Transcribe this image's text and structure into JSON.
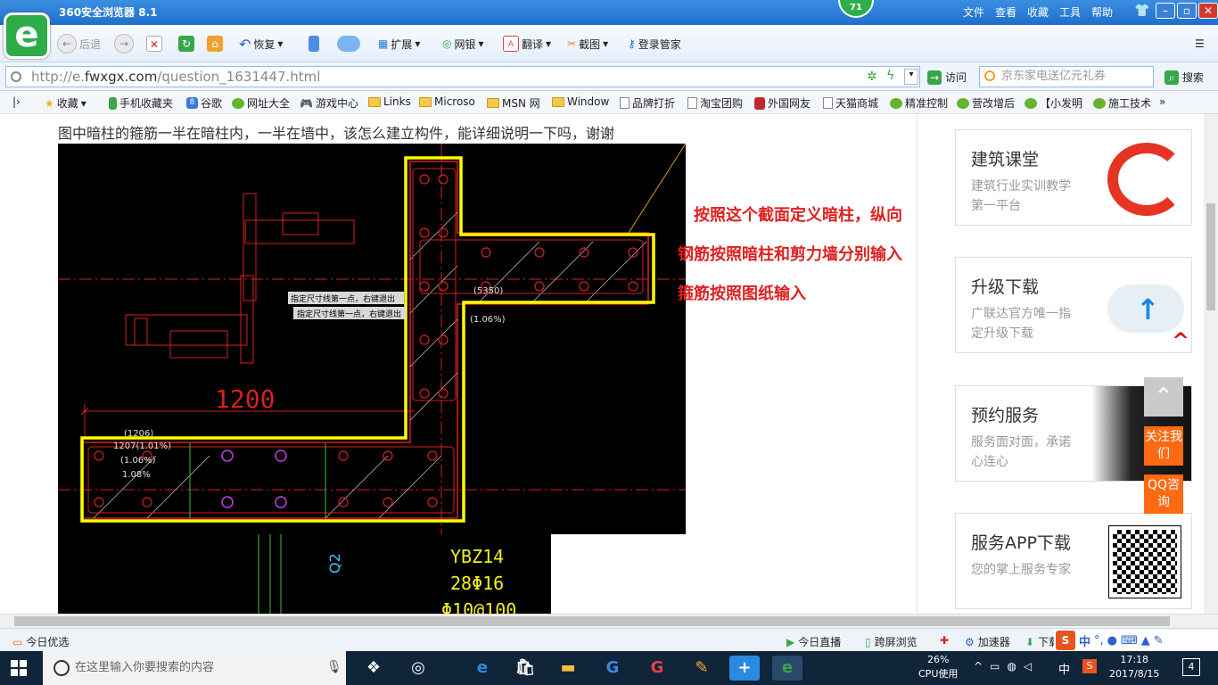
{
  "browser": {
    "title": "360安全浏览器 8.1",
    "badge": "71",
    "menu": [
      "文件",
      "查看",
      "收藏",
      "工具",
      "帮助"
    ],
    "toolbar": {
      "back": "后退",
      "restore": "恢复",
      "extend": "扩展",
      "bank": "网银",
      "translate": "翻译",
      "screenshot": "截图",
      "login": "登录管家"
    },
    "address": {
      "url_prefix": "http://e.",
      "url_domain": "fwxgx.com",
      "url_path": "/question_1631447.html",
      "go_label": "访问",
      "search_placeholder": "京东家电送亿元礼券",
      "search_button": "搜索"
    },
    "bookmarks": [
      "收藏",
      "手机收藏夹",
      "谷歌",
      "网址大全",
      "游戏中心",
      "Links",
      "Microso",
      "MSN 网",
      "Window",
      "品牌打折",
      "淘宝团购",
      "外国网友",
      "天猫商城",
      "精准控制",
      "营改增后",
      "【小发明",
      "施工技术"
    ]
  },
  "page": {
    "question": "图中暗柱的箍筋一半在暗柱内，一半在墙中，该怎么建立构件，能详细说明一下吗，谢谢",
    "annotation": [
      "按照这个截面定义暗柱，纵向",
      "钢筋按照暗柱和剪力墙分别输入",
      "箍筋按照图纸输入"
    ],
    "cad": {
      "dim": "1200",
      "label1": "指定尺寸线第一点，右键退出",
      "label2": "指定尺寸线第一点，右键退出",
      "t5350": "(5350)",
      "t_pct": "(1.06%)",
      "t1206": "(1206)",
      "t1207": "1207(1.01%)",
      "t106": "(1.06%)",
      "t108": "1.08%",
      "ybz": "YBZ14",
      "rebar": "28Φ16",
      "stirrup": "Φ10@100",
      "q2": "Q2"
    },
    "sidebar": [
      {
        "title": "建筑课堂",
        "sub": "建筑行业实训教学第一平台"
      },
      {
        "title": "升级下载",
        "sub": "广联达官方唯一指定升级下载"
      },
      {
        "title": "预约服务",
        "sub": "服务面对面，承诺心连心"
      },
      {
        "title": "服务APP下载",
        "sub": "您的掌上服务专家"
      }
    ],
    "float": {
      "follow": "关注我们",
      "qq": "QQ咨询"
    }
  },
  "statusbar": {
    "today": "今日优选",
    "live": "今日直播",
    "screen": "跨屏浏览",
    "speed": "加速器",
    "down": "下载"
  },
  "taskbar": {
    "search_placeholder": "在这里输入你要搜索的内容",
    "cpu_pct": "26%",
    "cpu_label": "CPU使用",
    "ime": "中",
    "time": "17:18",
    "date": "2017/8/15",
    "notif": "4"
  },
  "colors": {
    "titlebar": "#1f6fcc",
    "annotation": "#e02020",
    "cad_bg": "#000000",
    "cad_highlight": "#ffff00",
    "taskbar": "#10243a"
  }
}
